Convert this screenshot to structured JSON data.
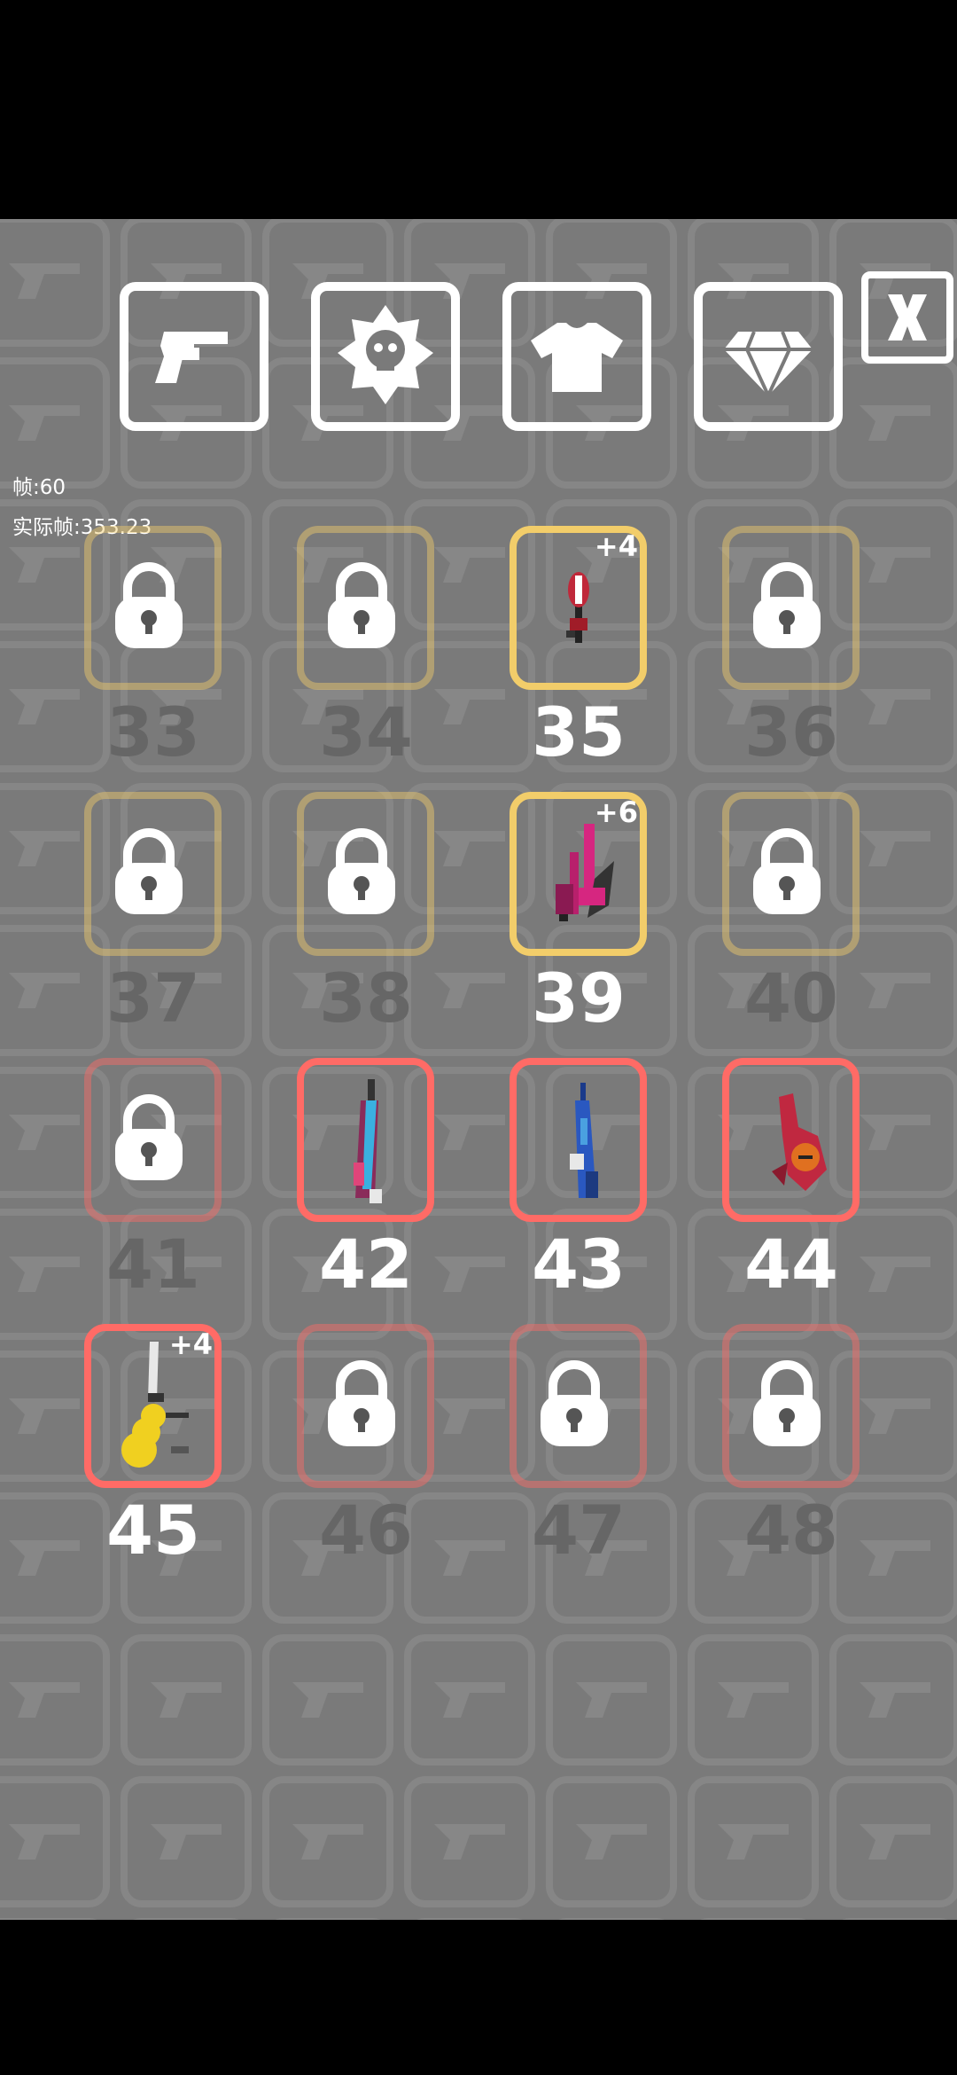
{
  "header": {
    "tabs": [
      {
        "name": "weapons-tab",
        "icon": "revolver-icon"
      },
      {
        "name": "skull-badge-tab",
        "icon": "skull-badge-icon"
      },
      {
        "name": "outfits-tab",
        "icon": "tshirt-icon"
      },
      {
        "name": "gems-tab",
        "icon": "diamond-icon"
      }
    ],
    "close_label": "X"
  },
  "debug": {
    "fps": "帧:60",
    "real_fps": "实际帧:353.23"
  },
  "colors": {
    "gold": "#f2cd6a",
    "red": "#ff6b66",
    "background": "#7a7a7a"
  },
  "slots": [
    {
      "num": "33",
      "tier": "gold",
      "locked": true,
      "plus": ""
    },
    {
      "num": "34",
      "tier": "gold",
      "locked": true,
      "plus": ""
    },
    {
      "num": "35",
      "tier": "gold",
      "locked": false,
      "plus": "+4",
      "icon": "red-scepter-gun-icon"
    },
    {
      "num": "36",
      "tier": "gold",
      "locked": true,
      "plus": ""
    },
    {
      "num": "37",
      "tier": "gold",
      "locked": true,
      "plus": ""
    },
    {
      "num": "38",
      "tier": "gold",
      "locked": true,
      "plus": ""
    },
    {
      "num": "39",
      "tier": "gold",
      "locked": false,
      "plus": "+6",
      "icon": "pink-launcher-icon"
    },
    {
      "num": "40",
      "tier": "gold",
      "locked": true,
      "plus": ""
    },
    {
      "num": "41",
      "tier": "red",
      "locked": true,
      "plus": ""
    },
    {
      "num": "42",
      "tier": "red",
      "locked": false,
      "plus": "",
      "icon": "neon-rifle-icon"
    },
    {
      "num": "43",
      "tier": "red",
      "locked": false,
      "plus": "",
      "icon": "blue-rifle-icon"
    },
    {
      "num": "44",
      "tier": "red",
      "locked": false,
      "plus": "",
      "icon": "red-pistol-icon"
    },
    {
      "num": "45",
      "tier": "red",
      "locked": false,
      "plus": "+4",
      "icon": "yellow-blade-gun-icon"
    },
    {
      "num": "46",
      "tier": "red",
      "locked": true,
      "plus": ""
    },
    {
      "num": "47",
      "tier": "red",
      "locked": true,
      "plus": ""
    },
    {
      "num": "48",
      "tier": "red",
      "locked": true,
      "plus": ""
    }
  ]
}
